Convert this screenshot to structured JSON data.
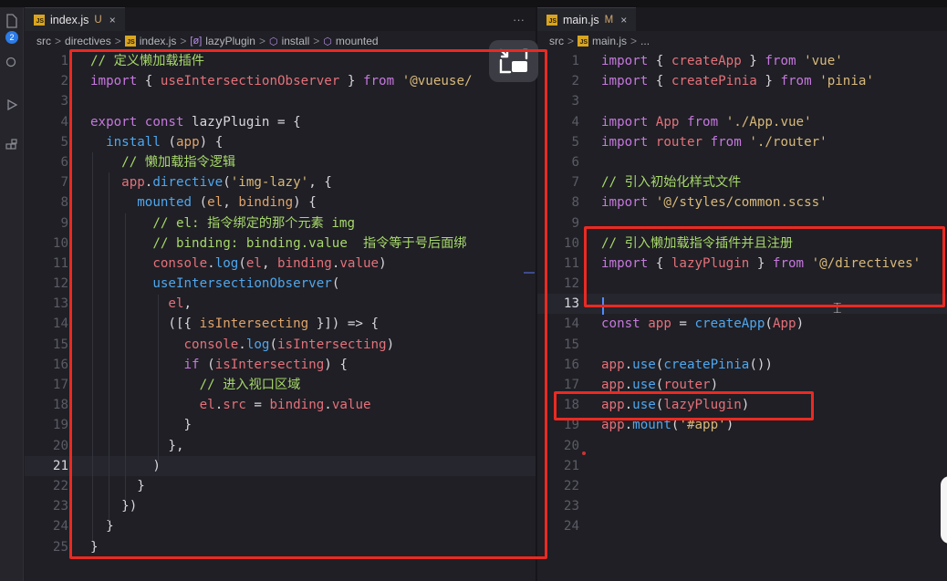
{
  "left_editor": {
    "tab": {
      "file": "index.js",
      "status": "U",
      "close": "×"
    },
    "more": "···",
    "breadcrumb": {
      "src": "src",
      "sep": ">",
      "directives": "directives",
      "file": "index.js",
      "plugin": "lazyPlugin",
      "install": "install",
      "mounted": "mounted"
    },
    "line_numbers": [
      "1",
      "2",
      "3",
      "4",
      "5",
      "6",
      "7",
      "8",
      "9",
      "10",
      "11",
      "12",
      "13",
      "14",
      "15",
      "16",
      "17",
      "18",
      "19",
      "20",
      "21",
      "22",
      "23",
      "24",
      "25"
    ],
    "lines": [
      [
        [
          "c",
          "// 定义懒加载插件"
        ]
      ],
      [
        [
          "k",
          "import"
        ],
        [
          "p",
          " { "
        ],
        [
          "v",
          "useIntersectionObserver"
        ],
        [
          "p",
          " } "
        ],
        [
          "k",
          "from"
        ],
        [
          "p",
          " "
        ],
        [
          "s",
          "'@vueuse/"
        ]
      ],
      [],
      [
        [
          "k",
          "export"
        ],
        [
          "p",
          " "
        ],
        [
          "k",
          "const"
        ],
        [
          "p",
          " lazyPlugin = {"
        ]
      ],
      [
        [
          "p",
          "  "
        ],
        [
          "f",
          "install"
        ],
        [
          "p",
          " ("
        ],
        [
          "pn",
          "app"
        ],
        [
          "p",
          ") {"
        ]
      ],
      [
        [
          "p",
          "    "
        ],
        [
          "c",
          "// 懒加载指令逻辑"
        ]
      ],
      [
        [
          "p",
          "    "
        ],
        [
          "v",
          "app"
        ],
        [
          "p",
          "."
        ],
        [
          "f",
          "directive"
        ],
        [
          "p",
          "("
        ],
        [
          "s",
          "'img-lazy'"
        ],
        [
          "p",
          ", {"
        ]
      ],
      [
        [
          "p",
          "      "
        ],
        [
          "f",
          "mounted"
        ],
        [
          "p",
          " ("
        ],
        [
          "pn",
          "el"
        ],
        [
          "p",
          ", "
        ],
        [
          "pn",
          "binding"
        ],
        [
          "p",
          ") {"
        ]
      ],
      [
        [
          "p",
          "        "
        ],
        [
          "c",
          "// el: 指令绑定的那个元素 img"
        ]
      ],
      [
        [
          "p",
          "        "
        ],
        [
          "c",
          "// binding: binding.value  指令等于号后面绑"
        ]
      ],
      [
        [
          "p",
          "        "
        ],
        [
          "v",
          "console"
        ],
        [
          "p",
          "."
        ],
        [
          "f",
          "log"
        ],
        [
          "p",
          "("
        ],
        [
          "v",
          "el"
        ],
        [
          "p",
          ", "
        ],
        [
          "v",
          "binding"
        ],
        [
          "p",
          "."
        ],
        [
          "v",
          "value"
        ],
        [
          "p",
          ")"
        ]
      ],
      [
        [
          "p",
          "        "
        ],
        [
          "f",
          "useIntersectionObserver"
        ],
        [
          "p",
          "("
        ]
      ],
      [
        [
          "p",
          "          "
        ],
        [
          "v",
          "el"
        ],
        [
          "p",
          ","
        ]
      ],
      [
        [
          "p",
          "          "
        ],
        [
          "p",
          "([{ "
        ],
        [
          "pn",
          "isIntersecting"
        ],
        [
          "p",
          " }]) => {"
        ]
      ],
      [
        [
          "p",
          "            "
        ],
        [
          "v",
          "console"
        ],
        [
          "p",
          "."
        ],
        [
          "f",
          "log"
        ],
        [
          "p",
          "("
        ],
        [
          "v",
          "isIntersecting"
        ],
        [
          "p",
          ")"
        ]
      ],
      [
        [
          "p",
          "            "
        ],
        [
          "k",
          "if"
        ],
        [
          "p",
          " ("
        ],
        [
          "v",
          "isIntersecting"
        ],
        [
          "p",
          ") {"
        ]
      ],
      [
        [
          "p",
          "              "
        ],
        [
          "c",
          "// 进入视口区域"
        ]
      ],
      [
        [
          "p",
          "              "
        ],
        [
          "v",
          "el"
        ],
        [
          "p",
          "."
        ],
        [
          "v",
          "src"
        ],
        [
          "p",
          " = "
        ],
        [
          "v",
          "binding"
        ],
        [
          "p",
          "."
        ],
        [
          "v",
          "value"
        ]
      ],
      [
        [
          "p",
          "            }"
        ]
      ],
      [
        [
          "p",
          "          },"
        ]
      ],
      [
        [
          "p",
          "        )"
        ]
      ],
      [
        [
          "p",
          "      }"
        ]
      ],
      [
        [
          "p",
          "    })"
        ]
      ],
      [
        [
          "p",
          "  }"
        ]
      ],
      [
        [
          "p",
          "}"
        ]
      ]
    ]
  },
  "right_editor": {
    "tab": {
      "file": "main.js",
      "status": "M",
      "close": "×"
    },
    "breadcrumb": {
      "src": "src",
      "sep": ">",
      "file": "main.js",
      "ellipsis": "..."
    },
    "line_numbers": [
      "1",
      "2",
      "3",
      "4",
      "5",
      "6",
      "7",
      "8",
      "9",
      "10",
      "11",
      "12",
      "13",
      "14",
      "15",
      "16",
      "17",
      "18",
      "19",
      "20",
      "21",
      "22",
      "23",
      "24"
    ],
    "lines": [
      [
        [
          "k",
          "import"
        ],
        [
          "p",
          " { "
        ],
        [
          "v",
          "createApp"
        ],
        [
          "p",
          " } "
        ],
        [
          "k",
          "from"
        ],
        [
          "p",
          " "
        ],
        [
          "s",
          "'vue'"
        ]
      ],
      [
        [
          "k",
          "import"
        ],
        [
          "p",
          " { "
        ],
        [
          "v",
          "createPinia"
        ],
        [
          "p",
          " } "
        ],
        [
          "k",
          "from"
        ],
        [
          "p",
          " "
        ],
        [
          "s",
          "'pinia'"
        ]
      ],
      [],
      [
        [
          "k",
          "import"
        ],
        [
          "p",
          " "
        ],
        [
          "v",
          "App"
        ],
        [
          "p",
          " "
        ],
        [
          "k",
          "from"
        ],
        [
          "p",
          " "
        ],
        [
          "s",
          "'./App.vue'"
        ]
      ],
      [
        [
          "k",
          "import"
        ],
        [
          "p",
          " "
        ],
        [
          "v",
          "router"
        ],
        [
          "p",
          " "
        ],
        [
          "k",
          "from"
        ],
        [
          "p",
          " "
        ],
        [
          "s",
          "'./router'"
        ]
      ],
      [],
      [
        [
          "c",
          "// 引入初始化样式文件"
        ]
      ],
      [
        [
          "k",
          "import"
        ],
        [
          "p",
          " "
        ],
        [
          "s",
          "'@/styles/common.scss'"
        ]
      ],
      [],
      [
        [
          "c",
          "// 引入懒加载指令插件并且注册"
        ]
      ],
      [
        [
          "k",
          "import"
        ],
        [
          "p",
          " { "
        ],
        [
          "v",
          "lazyPlugin"
        ],
        [
          "p",
          " } "
        ],
        [
          "k",
          "from"
        ],
        [
          "p",
          " "
        ],
        [
          "s",
          "'@/directives'"
        ]
      ],
      [],
      [],
      [
        [
          "k",
          "const"
        ],
        [
          "p",
          " "
        ],
        [
          "v",
          "app"
        ],
        [
          "p",
          " = "
        ],
        [
          "f",
          "createApp"
        ],
        [
          "p",
          "("
        ],
        [
          "v",
          "App"
        ],
        [
          "p",
          ")"
        ]
      ],
      [],
      [
        [
          "v",
          "app"
        ],
        [
          "p",
          "."
        ],
        [
          "f",
          "use"
        ],
        [
          "p",
          "("
        ],
        [
          "f",
          "createPinia"
        ],
        [
          "p",
          "())"
        ]
      ],
      [
        [
          "v",
          "app"
        ],
        [
          "p",
          "."
        ],
        [
          "f",
          "use"
        ],
        [
          "p",
          "("
        ],
        [
          "v",
          "router"
        ],
        [
          "p",
          ")"
        ]
      ],
      [
        [
          "v",
          "app"
        ],
        [
          "p",
          "."
        ],
        [
          "f",
          "use"
        ],
        [
          "p",
          "("
        ],
        [
          "v",
          "lazyPlugin"
        ],
        [
          "p",
          ")"
        ]
      ],
      [
        [
          "v",
          "app"
        ],
        [
          "p",
          "."
        ],
        [
          "f",
          "mount"
        ],
        [
          "p",
          "("
        ],
        [
          "s",
          "'#app'"
        ],
        [
          "p",
          ")"
        ]
      ],
      [],
      [],
      [],
      [],
      []
    ]
  },
  "activity": {
    "badge": "2"
  },
  "ibeam": "⌶"
}
